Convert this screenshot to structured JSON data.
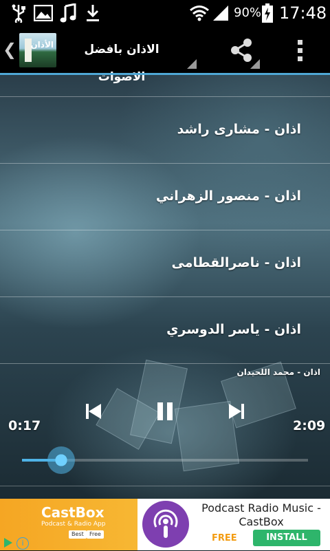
{
  "status_bar": {
    "battery_percent": "90%",
    "time": "17:48",
    "icons": [
      "usb-icon",
      "image-icon",
      "music-icon",
      "download-icon",
      "wifi-icon",
      "signal-icon",
      "battery-charging-icon"
    ]
  },
  "action_bar": {
    "title": "الاذان بافضل الاصوات",
    "logo_text": "الأذان",
    "icons": [
      "back-chevron-icon",
      "share-icon",
      "overflow-menu-icon"
    ]
  },
  "list": {
    "items": [
      {
        "label": "اذان - مشارى راشد"
      },
      {
        "label": "اذان - منصور الزهراني"
      },
      {
        "label": "اذان - ناصرالقطامى"
      },
      {
        "label": "اذان - ياسر الدوسري"
      }
    ]
  },
  "player": {
    "now_playing": "اذان - محمد اللحيدان",
    "elapsed": "0:17",
    "duration": "2:09",
    "progress_fraction": 0.136,
    "state": "playing"
  },
  "ad": {
    "brand": "CastBox",
    "brand_sub": "Podcast & Radio App",
    "chip_best": "Best",
    "chip_free": "Free",
    "title": "Podcast Radio Music - CastBox",
    "price": "FREE",
    "install_label": "INSTALL"
  },
  "colors": {
    "accent": "#4fa8d6",
    "install_green": "#2eb56b",
    "ad_orange": "#f5a623",
    "podcast_purple": "#7e3fb0"
  }
}
